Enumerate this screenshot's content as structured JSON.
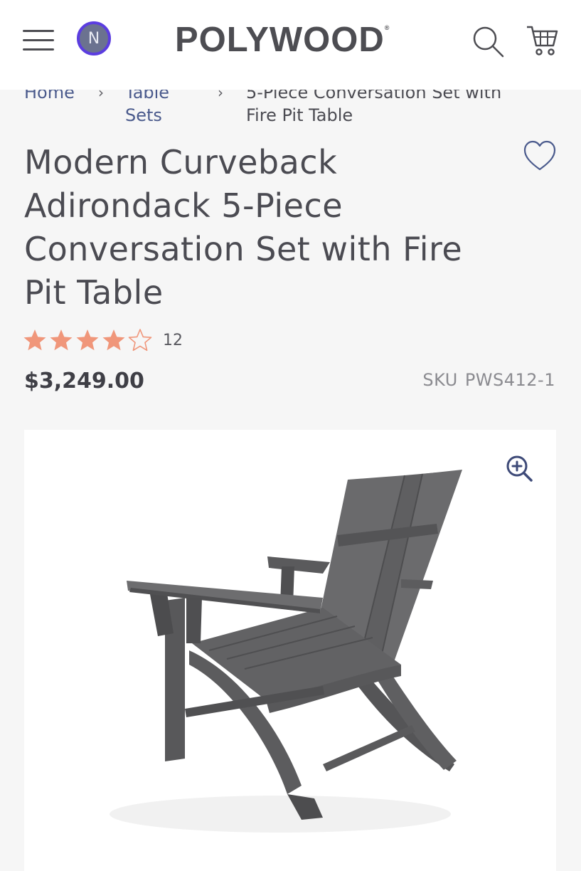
{
  "header": {
    "logo_text": "POLYWOOD",
    "logo_mark": "®",
    "avatar_initial": "N",
    "icons": [
      "menu-icon",
      "search-icon",
      "cart-icon"
    ]
  },
  "breadcrumb": {
    "items": [
      {
        "label": "Home"
      },
      {
        "label_line1": "Table",
        "label_line2": "Sets"
      },
      {
        "label_line1": "5-Piece Conversation Set with",
        "label_line2": "Fire Pit Table"
      }
    ]
  },
  "product": {
    "title_lines": [
      "Modern Curveback",
      "Adirondack 5-Piece",
      "Conversation Set with Fire",
      "Pit Table"
    ],
    "rating": 4,
    "rating_max": 5,
    "review_count": "12",
    "price": "$3,249.00",
    "sku_label": "SKU",
    "sku_value": "PWS412-1"
  },
  "colors": {
    "accent_star": "#f0967a",
    "avatar_ring": "#5b3de0",
    "link": "#4a5a8c",
    "zoom_icon": "#3e4a78"
  },
  "image": {
    "subject_icon": "adirondack-chair-image"
  }
}
